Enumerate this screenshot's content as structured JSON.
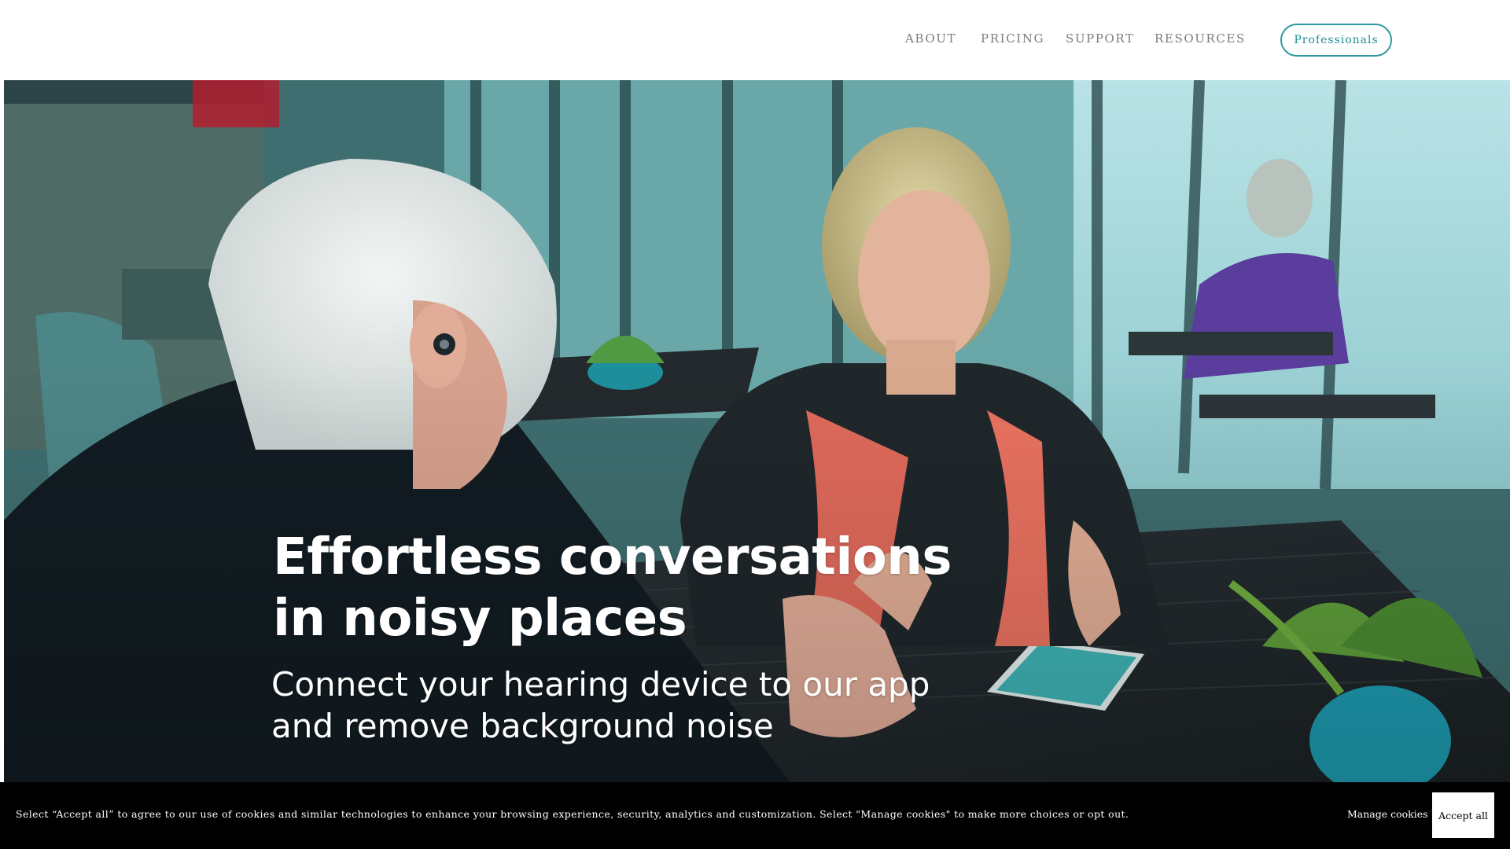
{
  "nav": {
    "items": [
      {
        "label": "ABOUT"
      },
      {
        "label": "PRICING"
      },
      {
        "label": "SUPPORT"
      },
      {
        "label": "RESOURCES"
      }
    ],
    "cta_label": "Professionals"
  },
  "hero": {
    "title_line1": "Effortless conversations",
    "title_line2": "in noisy places",
    "subtitle_line1": "Connect your hearing device to our app",
    "subtitle_line2": "and remove background noise"
  },
  "cookie_banner": {
    "text": "Select “Accept all” to agree to our use of cookies and similar technologies to enhance your browsing experience, security, analytics and customization. Select \"Manage cookies\" to make more choices or opt out.",
    "manage_label": "Manage cookies",
    "accept_label": "Accept all"
  },
  "colors": {
    "accent": "#2e9aa2",
    "nav_text": "#7c7c7c",
    "banner_bg": "#000000"
  }
}
